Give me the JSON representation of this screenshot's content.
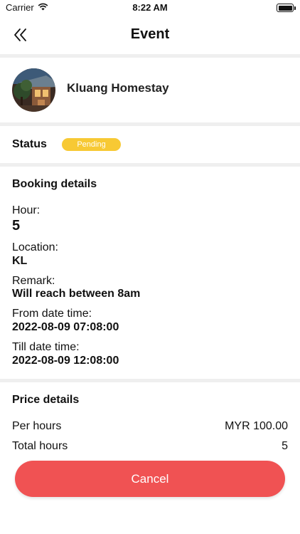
{
  "status_bar": {
    "carrier": "Carrier",
    "time": "8:22 AM"
  },
  "nav": {
    "title": "Event",
    "back_icon": "double-chevron-left-icon"
  },
  "profile": {
    "name": "Kluang Homestay"
  },
  "status": {
    "label": "Status",
    "value": "Pending",
    "badge_color": "#f7c934"
  },
  "booking": {
    "title": "Booking details",
    "hour_label": "Hour:",
    "hour_value": "5",
    "location_label": "Location:",
    "location_value": "KL",
    "remark_label": "Remark:",
    "remark_value": "Will reach between 8am",
    "from_label": "From date time:",
    "from_value": "2022-08-09 07:08:00",
    "till_label": "Till date time:",
    "till_value": "2022-08-09 12:08:00"
  },
  "price": {
    "title": "Price details",
    "per_hours_label": "Per hours",
    "per_hours_value": "MYR 100.00",
    "total_hours_label": "Total hours",
    "total_hours_value": "5"
  },
  "actions": {
    "cancel_label": "Cancel",
    "cancel_color": "#f05253"
  }
}
